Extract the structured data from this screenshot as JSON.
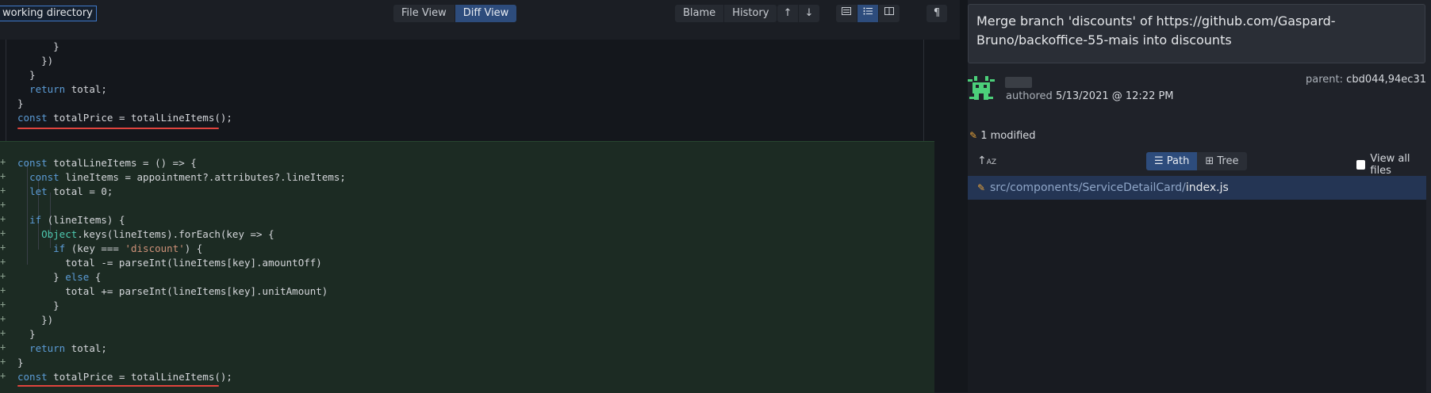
{
  "toolbar": {
    "working_directory": "working directory",
    "view_modes": [
      "File View",
      "Diff View"
    ],
    "active_view": "Diff View",
    "blame": "Blame",
    "history": "History",
    "up_icon": "↑",
    "down_icon": "↓",
    "pilcrow": "¶"
  },
  "code": {
    "context_lines": [
      "      }",
      "    })",
      "  }",
      "  return total;",
      "}",
      "const totalPrice = totalLineItems();"
    ],
    "added_lines": [
      "const totalLineItems = () => {",
      "  const lineItems = appointment?.attributes?.lineItems;",
      "  let total = 0;",
      "",
      "  if (lineItems) {",
      "    Object.keys(lineItems).forEach(key => {",
      "      if (key === 'discount') {",
      "        total -= parseInt(lineItems[key].amountOff)",
      "      } else {",
      "        total += parseInt(lineItems[key].unitAmount)",
      "      }",
      "    })",
      "  }",
      "  return total;",
      "}",
      "const totalPrice = totalLineItems();"
    ]
  },
  "commit": {
    "message": "Merge branch 'discounts' of https://github.com/Gaspard-Bruno/backoffice-55-mais into discounts",
    "authored_label": "authored",
    "authored_date": "5/13/2021 @ 12:22 PM",
    "parent_label": "parent:",
    "parent_value": "cbd044,94ec31",
    "modified_count": "1 modified"
  },
  "files_panel": {
    "path_label": "Path",
    "tree_label": "Tree",
    "view_all": "View all files",
    "files": [
      {
        "dir": "src/components/ServiceDetailCard/",
        "name": "index.js"
      }
    ]
  },
  "colors": {
    "accent": "#2d4c7c",
    "added_bg": "#1c2b23",
    "underline": "#e0443e"
  }
}
